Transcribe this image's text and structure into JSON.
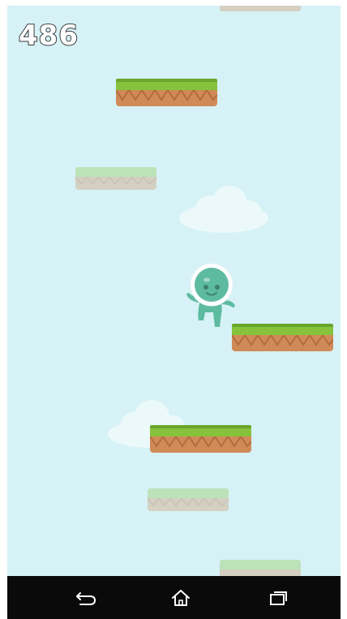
{
  "hud": {
    "score": "486"
  },
  "colors": {
    "sky": "#d6f2f6",
    "grass": "#86c23c",
    "grass_dark": "#6aa52d",
    "dirt": "#d08a57",
    "dirt_zigzag": "#b46a3e",
    "alien": "#5dbba0",
    "navbar": "#0a0a0a"
  },
  "navbar": {
    "back_icon": "back-arrow-icon",
    "home_icon": "home-icon",
    "recents_icon": "recent-apps-icon"
  }
}
